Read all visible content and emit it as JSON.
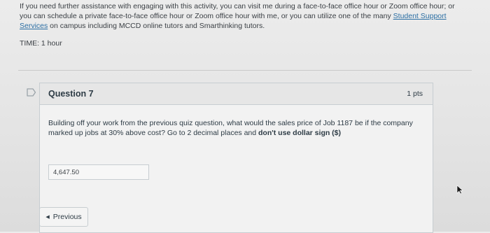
{
  "intro": {
    "text_before_link": "If you need further assistance with engaging with this activity, you can visit me during a face-to-face office hour or Zoom office hour; or you can schedule a private face-to-face office hour or Zoom office hour with me, or you can utilize one of the many ",
    "link_label": "Student Support Services",
    "text_after_link": " on campus including MCCD online tutors and Smarthinking tutors."
  },
  "time_label": "TIME: 1 hour",
  "question": {
    "title": "Question 7",
    "points": "1 pts",
    "text_main": "Building off your work from the previous quiz question, what would the sales price of Job 1187 be if the company marked up jobs at 30% above cost?  Go to 2 decimal places and ",
    "text_bold": "don't use dollar sign ($)",
    "answer_value": "4,647.50"
  },
  "nav": {
    "previous_label": "Previous"
  },
  "colors": {
    "link": "#2b6ea3",
    "text": "#2d3b45",
    "header_bg": "#e6e6e6",
    "border": "#c7cdd1"
  },
  "icons": {
    "flag": "flag-icon",
    "chevron": "chevron-left-icon",
    "cursor": "mouse-cursor-icon"
  }
}
